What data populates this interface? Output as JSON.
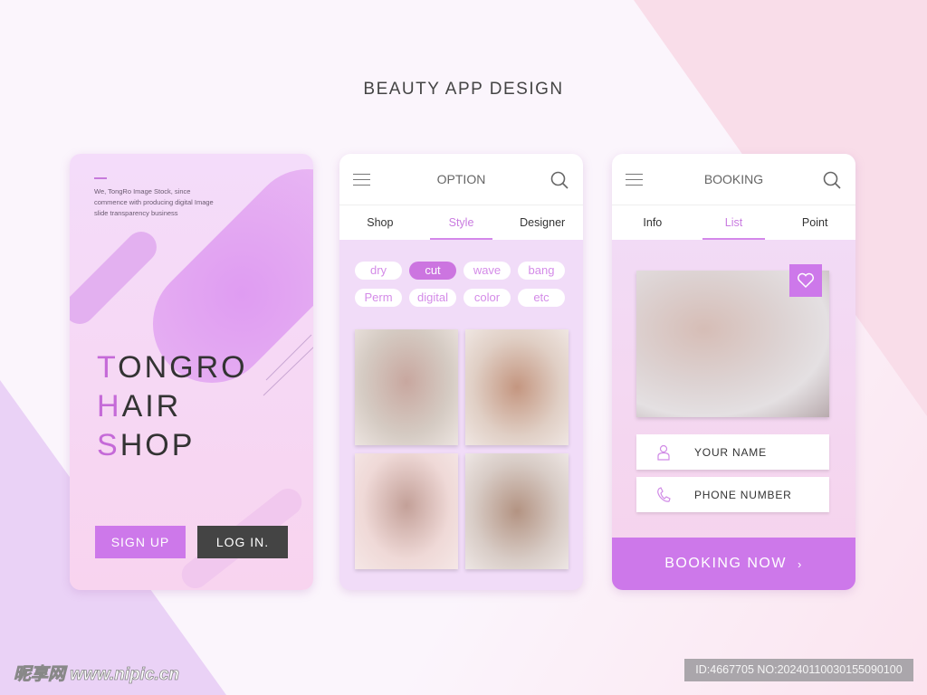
{
  "page_title": "BEAUTY APP DESIGN",
  "colors": {
    "accent": "#cd78ea",
    "dark_button": "#444444"
  },
  "card1": {
    "intro": "We, TongRo Image Stock, since commence with producing digital Image slide transparency business",
    "lines": [
      {
        "initial": "T",
        "rest": "ONGRO"
      },
      {
        "initial": "H",
        "rest": "AIR"
      },
      {
        "initial": "S",
        "rest": "HOP"
      }
    ],
    "signup": "SIGN UP",
    "login": "LOG IN."
  },
  "card2": {
    "header": "OPTION",
    "tabs": [
      "Shop",
      "Style",
      "Designer"
    ],
    "active_tab": "Style",
    "chips": [
      "dry",
      "cut",
      "wave",
      "bang",
      "Perm",
      "digital",
      "color",
      "etc"
    ],
    "active_chip": "cut"
  },
  "card3": {
    "header": "BOOKING",
    "tabs": [
      "Info",
      "List",
      "Point"
    ],
    "active_tab": "List",
    "name_field": "YOUR NAME",
    "phone_field": "PHONE NUMBER",
    "booking_button": "BOOKING NOW",
    "booking_arrow": "›"
  },
  "watermark": {
    "logo": "昵享网 www.nipic.cn",
    "id": "ID:4667705 NO:20240110030155090100"
  }
}
